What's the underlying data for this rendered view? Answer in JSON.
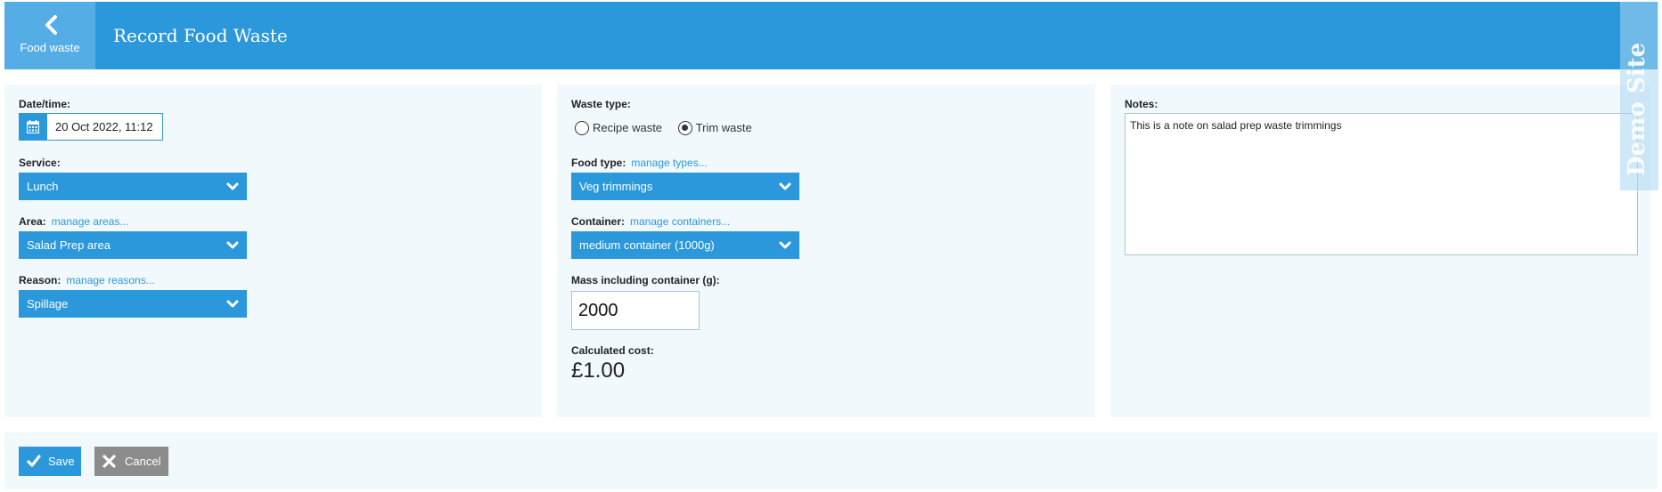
{
  "header": {
    "back_label": "Food waste",
    "title": "Record Food Waste"
  },
  "left_panel": {
    "datetime_label": "Date/time:",
    "datetime_value": "20 Oct 2022, 11:12",
    "service_label": "Service:",
    "service_value": "Lunch",
    "area_label": "Area:",
    "area_link": "manage areas...",
    "area_value": "Salad Prep area",
    "reason_label": "Reason:",
    "reason_link": "manage reasons...",
    "reason_value": "Spillage"
  },
  "middle_panel": {
    "waste_type_label": "Waste type:",
    "waste_type_options": [
      "Recipe waste",
      "Trim waste"
    ],
    "waste_type_selected": "Trim waste",
    "food_type_label": "Food type:",
    "food_type_link": "manage types...",
    "food_type_value": "Veg trimmings",
    "container_label": "Container:",
    "container_link": "manage containers...",
    "container_value": "medium container (1000g)",
    "mass_label": "Mass including container (g):",
    "mass_value": "2000",
    "cost_label": "Calculated cost:",
    "cost_value": "£1.00"
  },
  "right_panel": {
    "notes_label": "Notes:",
    "notes_value": "This is a note on salad prep waste trimmings"
  },
  "footer": {
    "save_label": "Save",
    "cancel_label": "Cancel"
  },
  "watermark": "Demo Site",
  "icons": {
    "back": "chevron-left-icon",
    "calendar": "calendar-icon",
    "dropdown": "chevron-down-icon",
    "save": "check-icon",
    "cancel": "close-icon"
  },
  "colors": {
    "primary": "#2b98dc",
    "header_back": "#55ade5",
    "panel_bg": "#f1f9fd",
    "cancel_bg": "#8c8c8c"
  }
}
